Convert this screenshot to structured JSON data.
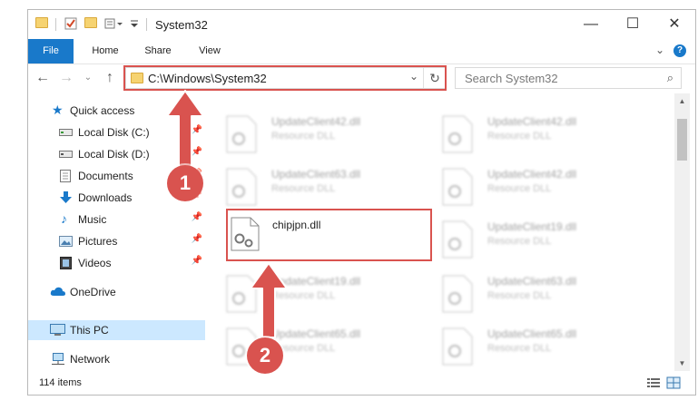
{
  "window": {
    "title": "System32",
    "controls": {
      "minimize": "—",
      "maximize": "☐",
      "close": "✕"
    }
  },
  "ribbon": {
    "tabs": [
      {
        "label": "File",
        "active": true
      },
      {
        "label": "Home"
      },
      {
        "label": "Share"
      },
      {
        "label": "View"
      }
    ],
    "help_label": "?"
  },
  "navigation": {
    "address_path": "C:\\Windows\\System32",
    "search_placeholder": "Search System32"
  },
  "sidebar": {
    "items": [
      {
        "label": "Quick access",
        "icon": "star-icon"
      },
      {
        "label": "Local Disk (C:)",
        "icon": "drive-icon",
        "pinned": true
      },
      {
        "label": "Local Disk (D:)",
        "icon": "drive-icon",
        "pinned": true
      },
      {
        "label": "Documents",
        "icon": "documents-icon",
        "pinned": true
      },
      {
        "label": "Downloads",
        "icon": "download-icon",
        "pinned": true
      },
      {
        "label": "Music",
        "icon": "music-icon",
        "pinned": true
      },
      {
        "label": "Pictures",
        "icon": "pictures-icon",
        "pinned": true
      },
      {
        "label": "Videos",
        "icon": "videos-icon",
        "pinned": true
      },
      {
        "label": "OneDrive",
        "icon": "cloud-icon"
      },
      {
        "label": "This PC",
        "icon": "computer-icon",
        "selected": true
      },
      {
        "label": "Network",
        "icon": "network-icon"
      }
    ]
  },
  "files": {
    "left_column": [
      {
        "name": "UpdateClient42.dll",
        "type": "Resource DLL"
      },
      {
        "name": "UpdateClient63.dll",
        "type": "Resource DLL"
      },
      {
        "name": "UpdateClient19.dll",
        "type": "Resource DLL"
      },
      {
        "name": "UpdateClient65.dll",
        "type": "Resource DLL"
      }
    ],
    "right_column": [
      {
        "name": "UpdateClient42.dll",
        "type": "Resource DLL"
      },
      {
        "name": "UpdateClient42.dll",
        "type": "Resource DLL"
      },
      {
        "name": "UpdateClient19.dll",
        "type": "Resource DLL"
      },
      {
        "name": "UpdateClient63.dll",
        "type": "Resource DLL"
      },
      {
        "name": "UpdateClient65.dll",
        "type": "Resource DLL"
      }
    ],
    "highlighted_file": {
      "name": "chipjpn.dll"
    }
  },
  "status": {
    "item_count": "114 items"
  },
  "annotations": {
    "step1": "1",
    "step2": "2"
  },
  "colors": {
    "accent": "#1979ca",
    "highlight": "#d9534f",
    "selection": "#cce8ff"
  }
}
